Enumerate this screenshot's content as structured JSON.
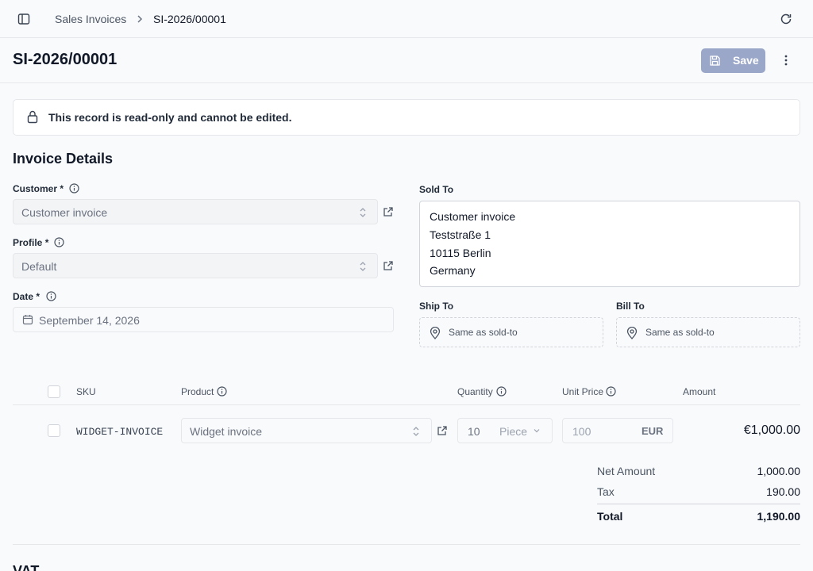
{
  "breadcrumb": {
    "parent": "Sales Invoices",
    "current": "SI-2026/00001"
  },
  "header": {
    "title": "SI-2026/00001",
    "save_label": "Save"
  },
  "notice": {
    "text": "This record is read-only and cannot be edited."
  },
  "section": {
    "title": "Invoice Details"
  },
  "fields": {
    "customer": {
      "label": "Customer",
      "required": "*",
      "value": "Customer invoice"
    },
    "profile": {
      "label": "Profile",
      "required": "*",
      "value": "Default"
    },
    "date": {
      "label": "Date",
      "required": "*",
      "value": "September 14, 2026"
    }
  },
  "sold_to": {
    "label": "Sold To",
    "lines": [
      "Customer invoice",
      "Teststraße 1",
      "10115 Berlin",
      "Germany"
    ]
  },
  "ship_to": {
    "label": "Ship To",
    "value": "Same as sold-to"
  },
  "bill_to": {
    "label": "Bill To",
    "value": "Same as sold-to"
  },
  "table": {
    "headers": {
      "sku": "SKU",
      "product": "Product",
      "quantity": "Quantity",
      "unit_price": "Unit Price",
      "amount": "Amount"
    },
    "rows": [
      {
        "sku": "WIDGET-INVOICE",
        "product": "Widget invoice",
        "quantity": "10",
        "unit": "Piece",
        "unit_price": "100",
        "currency": "EUR",
        "amount": "€1,000.00"
      }
    ]
  },
  "summary": {
    "net_label": "Net Amount",
    "net_value": "1,000.00",
    "tax_label": "Tax",
    "tax_value": "190.00",
    "total_label": "Total",
    "total_value": "1,190.00"
  },
  "next_section": {
    "title": "VAT"
  },
  "colors": {
    "accent": "#9aa7c8",
    "background": "#f9fafb",
    "border": "#e5e7eb"
  },
  "icons": [
    "sidebar-toggle-icon",
    "chevron-right-icon",
    "refresh-icon",
    "save-icon",
    "more-vertical-icon",
    "lock-icon",
    "info-icon",
    "chevron-up-down-icon",
    "external-link-icon",
    "calendar-icon",
    "map-pin-icon",
    "chevron-down-icon"
  ]
}
